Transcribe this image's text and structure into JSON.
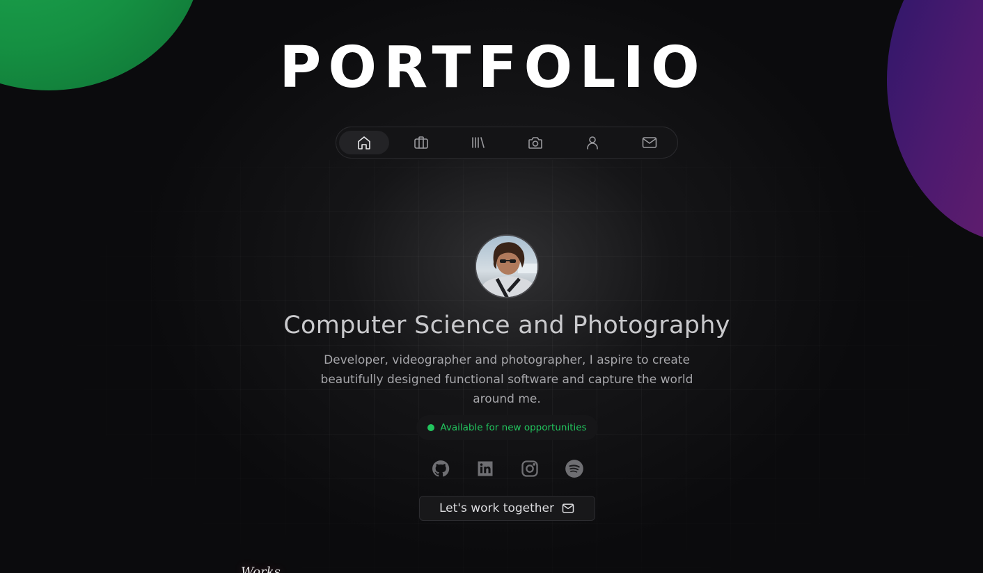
{
  "header": {
    "title": "PORTFOLIO"
  },
  "nav": {
    "items": [
      {
        "icon": "home-icon",
        "active": true
      },
      {
        "icon": "briefcase-icon",
        "active": false
      },
      {
        "icon": "library-icon",
        "active": false
      },
      {
        "icon": "camera-icon",
        "active": false
      },
      {
        "icon": "user-icon",
        "active": false
      },
      {
        "icon": "mail-icon",
        "active": false
      }
    ]
  },
  "hero": {
    "headline": "Computer Science and Photography",
    "description": "Developer, videographer and photographer, I aspire to create beautifully designed functional software and capture the world around me.",
    "status": "Available for new opportunities",
    "socials": [
      {
        "icon": "github-icon"
      },
      {
        "icon": "linkedin-icon"
      },
      {
        "icon": "instagram-icon"
      },
      {
        "icon": "spotify-icon"
      }
    ],
    "cta_label": "Let's work together"
  },
  "next_section": {
    "label": "Works"
  },
  "colors": {
    "background": "#0b0b0d",
    "accent_green": "#22c55e",
    "blob_green": "#159042",
    "blob_purple": "#5a1b6e"
  }
}
